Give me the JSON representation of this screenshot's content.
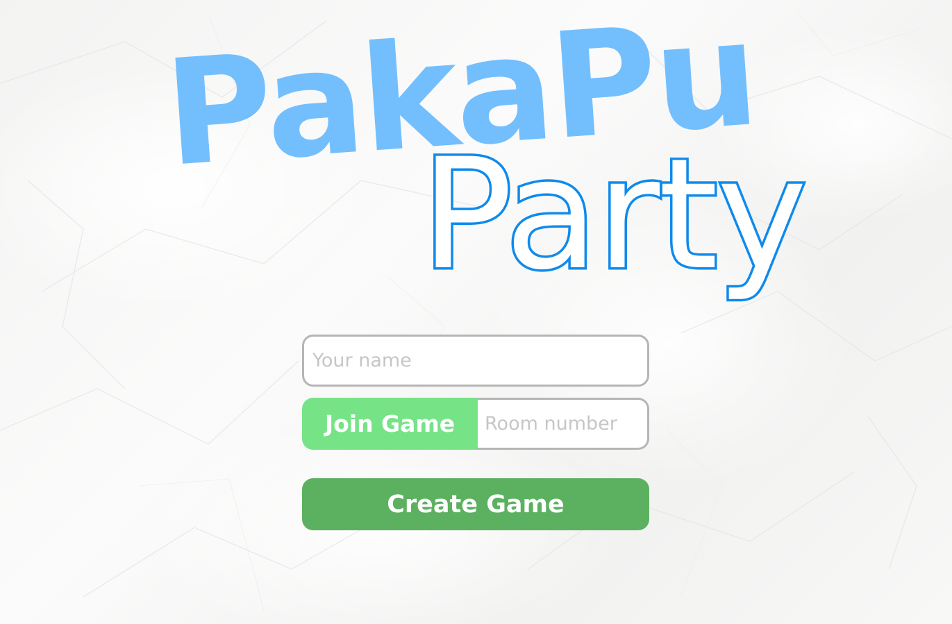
{
  "logo": {
    "top": "PakaPu",
    "bottom": "Party"
  },
  "form": {
    "name_placeholder": "Your name",
    "join_label": "Join Game",
    "room_placeholder": "Room number",
    "create_label": "Create Game"
  },
  "colors": {
    "logo_top": "#73bffd",
    "logo_outline": "#0e8aec",
    "join_button": "#76e387",
    "create_button": "#5bb15f",
    "input_border": "#b5b5b5"
  }
}
